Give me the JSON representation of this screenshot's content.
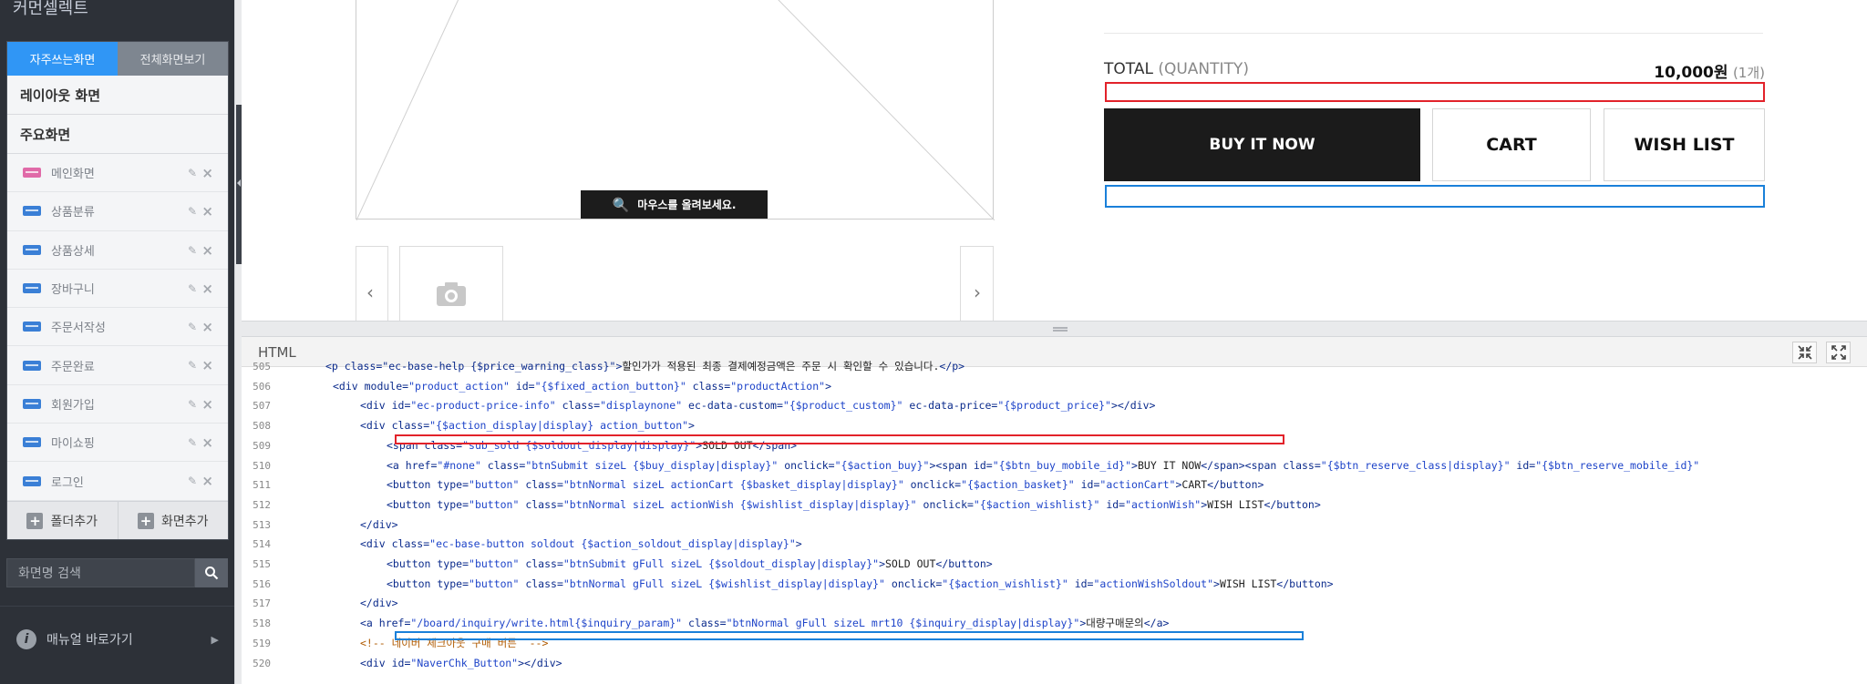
{
  "left_panel": {
    "title": "커먼셀렉트",
    "tabs": [
      {
        "label": "자주쓰는화면",
        "active": true
      },
      {
        "label": "전체화면보기",
        "active": false
      }
    ],
    "sections": [
      "레이아웃 화면",
      "주요화면"
    ],
    "items": [
      {
        "label": "메인화면",
        "color": "#e06aa8"
      },
      {
        "label": "상품분류",
        "color": "#3a7fd6"
      },
      {
        "label": "상품상세",
        "color": "#3a7fd6"
      },
      {
        "label": "장바구니",
        "color": "#3a7fd6"
      },
      {
        "label": "주문서작성",
        "color": "#3a7fd6"
      },
      {
        "label": "주문완료",
        "color": "#3a7fd6"
      },
      {
        "label": "회원가입",
        "color": "#3a7fd6"
      },
      {
        "label": "마이쇼핑",
        "color": "#3a7fd6"
      },
      {
        "label": "로그인",
        "color": "#3a7fd6"
      }
    ],
    "footer": {
      "add_folder": "폴더추가",
      "add_screen": "화면추가"
    },
    "search_placeholder": "화면명 검색",
    "manual": "매뉴얼 바로가기"
  },
  "preview": {
    "mouse_hint": "마우스를 올려보세요.",
    "total_label": "TOTAL",
    "quantity_label": "(QUANTITY)",
    "price": "10,000원",
    "count": "(1개)",
    "buy_now": "BUY IT NOW",
    "cart": "CART",
    "wish_list": "WISH LIST"
  },
  "editor": {
    "label": "HTML",
    "lines": [
      {
        "n": "505",
        "indent": 0,
        "parts": [
          [
            "tag",
            "<p class=\"ec-base-help {$price_warning_class}\">"
          ],
          [
            "txt",
            "할인가가 적용된 최종 결제예정금액은 주문 시 확인할 수 있습니다."
          ],
          [
            "tag",
            "</p>"
          ]
        ]
      },
      {
        "n": "506",
        "indent": 1,
        "parts": [
          [
            "tag",
            "<div module="
          ],
          [
            "str",
            "\"product_action\""
          ],
          [
            "tag",
            " id="
          ],
          [
            "str",
            "\"{$fixed_action_button}\""
          ],
          [
            "tag",
            " class="
          ],
          [
            "str",
            "\"productAction\""
          ],
          [
            "tag",
            ">"
          ]
        ]
      },
      {
        "n": "507",
        "indent": 2,
        "parts": [
          [
            "tag",
            "<div id="
          ],
          [
            "str",
            "\"ec-product-price-info\""
          ],
          [
            "tag",
            " class="
          ],
          [
            "str",
            "\"displaynone\""
          ],
          [
            "tag",
            " ec-data-custom="
          ],
          [
            "str",
            "\"{$product_custom}\""
          ],
          [
            "tag",
            " ec-data-price="
          ],
          [
            "str",
            "\"{$product_price}\""
          ],
          [
            "tag",
            "></div>"
          ]
        ]
      },
      {
        "n": "508",
        "indent": 2,
        "parts": [
          [
            "tag",
            "<div class="
          ],
          [
            "str",
            "\"{$action_display|display} action_button\""
          ],
          [
            "tag",
            ">"
          ]
        ]
      },
      {
        "n": "509",
        "indent": 3,
        "parts": [
          [
            "tag",
            "<span class="
          ],
          [
            "str",
            "\"sub_sold {$soldout_display|display}\""
          ],
          [
            "tag",
            ">"
          ],
          [
            "txt",
            "SOLD OUT"
          ],
          [
            "tag",
            "</span>"
          ]
        ]
      },
      {
        "n": "510",
        "indent": 3,
        "parts": [
          [
            "tag",
            "<a href="
          ],
          [
            "str",
            "\"#none\""
          ],
          [
            "tag",
            " class="
          ],
          [
            "str",
            "\"btnSubmit sizeL {$buy_display|display}\""
          ],
          [
            "tag",
            " onclick="
          ],
          [
            "str",
            "\"{$action_buy}\""
          ],
          [
            "tag",
            "><span id="
          ],
          [
            "str",
            "\"{$btn_buy_mobile_id}\""
          ],
          [
            "tag",
            ">"
          ],
          [
            "txt",
            "BUY IT NOW"
          ],
          [
            "tag",
            "</span><span class="
          ],
          [
            "str",
            "\"{$btn_reserve_class|display}\""
          ],
          [
            "tag",
            " id="
          ],
          [
            "str",
            "\"{$btn_reserve_mobile_id}\""
          ]
        ]
      },
      {
        "n": "511",
        "indent": 3,
        "parts": [
          [
            "tag",
            "<button type="
          ],
          [
            "str",
            "\"button\""
          ],
          [
            "tag",
            " class="
          ],
          [
            "str",
            "\"btnNormal sizeL actionCart {$basket_display|display}\""
          ],
          [
            "tag",
            " onclick="
          ],
          [
            "str",
            "\"{$action_basket}\""
          ],
          [
            "tag",
            " id="
          ],
          [
            "str",
            "\"actionCart\""
          ],
          [
            "tag",
            ">"
          ],
          [
            "txt",
            "CART"
          ],
          [
            "tag",
            "</button>"
          ]
        ]
      },
      {
        "n": "512",
        "indent": 3,
        "parts": [
          [
            "tag",
            "<button type="
          ],
          [
            "str",
            "\"button\""
          ],
          [
            "tag",
            " class="
          ],
          [
            "str",
            "\"btnNormal sizeL actionWish {$wishlist_display|display}\""
          ],
          [
            "tag",
            " onclick="
          ],
          [
            "str",
            "\"{$action_wishlist}\""
          ],
          [
            "tag",
            " id="
          ],
          [
            "str",
            "\"actionWish\""
          ],
          [
            "tag",
            ">"
          ],
          [
            "txt",
            "WISH LIST"
          ],
          [
            "tag",
            "</button>"
          ]
        ]
      },
      {
        "n": "513",
        "indent": 2,
        "parts": [
          [
            "tag",
            "</div>"
          ]
        ]
      },
      {
        "n": "514",
        "indent": 2,
        "parts": [
          [
            "tag",
            "<div class="
          ],
          [
            "str",
            "\"ec-base-button soldout {$action_soldout_display|display}\""
          ],
          [
            "tag",
            ">"
          ]
        ]
      },
      {
        "n": "515",
        "indent": 3,
        "parts": [
          [
            "tag",
            "<button type="
          ],
          [
            "str",
            "\"button\""
          ],
          [
            "tag",
            " class="
          ],
          [
            "str",
            "\"btnSubmit gFull sizeL {$soldout_display|display}\""
          ],
          [
            "tag",
            ">"
          ],
          [
            "txt",
            "SOLD OUT"
          ],
          [
            "tag",
            "</button>"
          ]
        ]
      },
      {
        "n": "516",
        "indent": 3,
        "parts": [
          [
            "tag",
            "<button type="
          ],
          [
            "str",
            "\"button\""
          ],
          [
            "tag",
            " class="
          ],
          [
            "str",
            "\"btnNormal gFull sizeL {$wishlist_display|display}\""
          ],
          [
            "tag",
            " onclick="
          ],
          [
            "str",
            "\"{$action_wishlist}\""
          ],
          [
            "tag",
            " id="
          ],
          [
            "str",
            "\"actionWishSoldout\""
          ],
          [
            "tag",
            ">"
          ],
          [
            "txt",
            "WISH LIST"
          ],
          [
            "tag",
            "</button>"
          ]
        ]
      },
      {
        "n": "517",
        "indent": 2,
        "parts": [
          [
            "tag",
            "</div>"
          ]
        ]
      },
      {
        "n": "518",
        "indent": 2,
        "parts": [
          [
            "tag",
            "<a href="
          ],
          [
            "str",
            "\"/board/inquiry/write.html{$inquiry_param}\""
          ],
          [
            "tag",
            " class="
          ],
          [
            "str",
            "\"btnNormal gFull sizeL mrt10 {$inquiry_display|display}\""
          ],
          [
            "tag",
            ">"
          ],
          [
            "txt",
            "대량구매문의"
          ],
          [
            "tag",
            "</a>"
          ]
        ]
      },
      {
        "n": "519",
        "indent": 2,
        "parts": [
          [
            "com",
            "<!-- 네이버 체크아웃 구매 버튼  -->"
          ]
        ]
      },
      {
        "n": "520",
        "indent": 2,
        "parts": [
          [
            "tag",
            "<div id="
          ],
          [
            "str",
            "\"NaverChk_Button\""
          ],
          [
            "tag",
            "></div>"
          ]
        ]
      }
    ]
  }
}
